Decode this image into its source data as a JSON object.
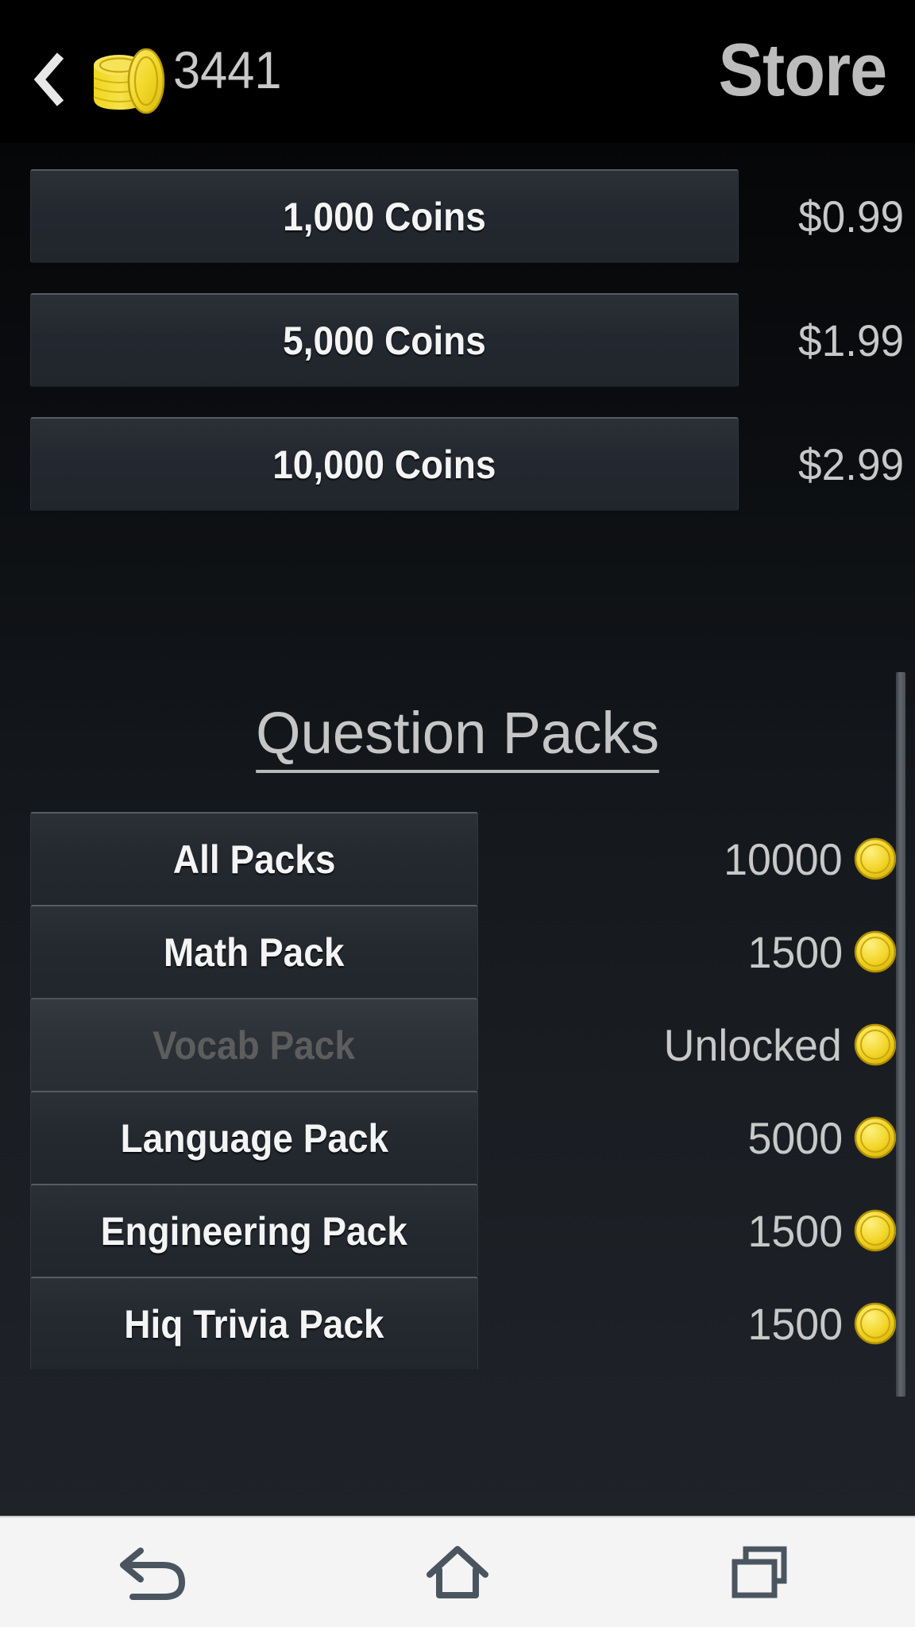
{
  "header": {
    "back_icon": "chevron-left-icon",
    "coin_icon": "coin-stack-icon",
    "coin_balance": "3441",
    "title": "Store"
  },
  "coin_packs": [
    {
      "label": "1,000 Coins",
      "price": "$0.99"
    },
    {
      "label": "5,000 Coins",
      "price": "$1.99"
    },
    {
      "label": "10,000 Coins",
      "price": "$2.99"
    }
  ],
  "section": {
    "heading": "Question Packs"
  },
  "question_packs": [
    {
      "label": "All Packs",
      "price": "10000",
      "state": "available"
    },
    {
      "label": "Math Pack",
      "price": "1500",
      "state": "available"
    },
    {
      "label": "Vocab Pack",
      "price": "Unlocked",
      "state": "unlocked"
    },
    {
      "label": "Language Pack",
      "price": "5000",
      "state": "available"
    },
    {
      "label": "Engineering Pack",
      "price": "1500",
      "state": "available"
    },
    {
      "label": "Hiq Trivia Pack",
      "price": "1500",
      "state": "available"
    }
  ],
  "navbar": [
    {
      "icon": "back-arrow-icon"
    },
    {
      "icon": "home-icon"
    },
    {
      "icon": "recent-apps-icon"
    }
  ],
  "colors": {
    "background_top": "#000000",
    "background_bottom": "#202429",
    "button_fill": "#242930",
    "button_highlight": "#565c64",
    "text_primary": "#f4f4f4",
    "text_secondary": "#c8c8c8",
    "text_disabled": "#5d5d5d",
    "coin_gold": "#f2d42a",
    "navbar_bg": "#f4f4f4",
    "navbar_icon": "#4a5560",
    "scrollbar_thumb": "#61666c"
  }
}
